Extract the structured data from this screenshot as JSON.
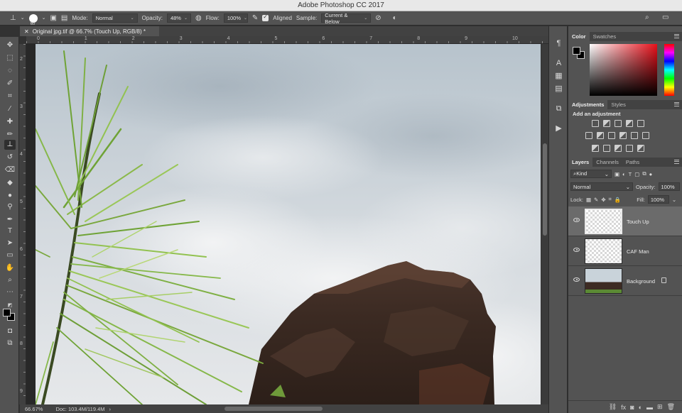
{
  "app": {
    "title": "Adobe Photoshop CC 2017"
  },
  "options_bar": {
    "brush_size": "60",
    "mode_label": "Mode:",
    "mode_value": "Normal",
    "opacity_label": "Opacity:",
    "opacity_value": "48%",
    "flow_label": "Flow:",
    "flow_value": "100%",
    "aligned_label": "Aligned",
    "aligned_checked": true,
    "sample_label": "Sample:",
    "sample_value": "Current & Below",
    "icons": [
      "clone-stamp-tool-icon",
      "brush-preset-icon",
      "toggle-brush-panel-icon",
      "toggle-clone-source-icon",
      "pressure-opacity-icon",
      "airbrush-icon",
      "ignore-adjustment-layers-icon",
      "pressure-size-icon",
      "search-icon",
      "workspace-icon"
    ]
  },
  "document": {
    "tab_title": "Original jpg.tif @ 66.7% (Touch Up, RGB/8) *",
    "zoom": "66.67%",
    "doc_size": "Doc: 103.4M/119.4M"
  },
  "ruler": {
    "top": [
      "0",
      "1",
      "2",
      "3",
      "4",
      "5",
      "6",
      "7",
      "8",
      "9",
      "10"
    ],
    "left": [
      "2",
      "3",
      "4",
      "5",
      "6",
      "7",
      "8",
      "9"
    ]
  },
  "toolbar": {
    "tools": [
      "move-tool-icon",
      "marquee-tool-icon",
      "lasso-tool-icon",
      "quick-selection-tool-icon",
      "crop-tool-icon",
      "eyedropper-tool-icon",
      "healing-brush-tool-icon",
      "brush-tool-icon",
      "clone-stamp-tool-icon",
      "history-brush-tool-icon",
      "eraser-tool-icon",
      "paint-bucket-tool-icon",
      "blur-tool-icon",
      "dodge-tool-icon",
      "pen-tool-icon",
      "type-tool-icon",
      "path-selection-tool-icon",
      "rectangle-tool-icon",
      "hand-tool-icon",
      "zoom-tool-icon",
      "more-tools-icon"
    ],
    "active_tool": "clone-stamp-tool-icon",
    "foreground_color": "#000000",
    "background_color": "#000000"
  },
  "panels": {
    "color": {
      "tabs": [
        "Color",
        "Swatches"
      ]
    },
    "adjustments": {
      "tabs": [
        "Adjustments",
        "Styles"
      ],
      "hint": "Add an adjustment"
    },
    "layers": {
      "tabs": [
        "Layers",
        "Channels",
        "Paths"
      ],
      "filter_kind": "Kind",
      "blend_mode": "Normal",
      "opacity_label": "Opacity:",
      "opacity_value": "100%",
      "lock_label": "Lock:",
      "fill_label": "Fill:",
      "fill_value": "100%",
      "items": [
        {
          "name": "Touch Up",
          "visible": true,
          "selected": true,
          "locked": false
        },
        {
          "name": "CAF Man",
          "visible": true,
          "selected": false,
          "locked": false
        },
        {
          "name": "Background",
          "visible": true,
          "selected": false,
          "locked": true
        }
      ]
    }
  }
}
